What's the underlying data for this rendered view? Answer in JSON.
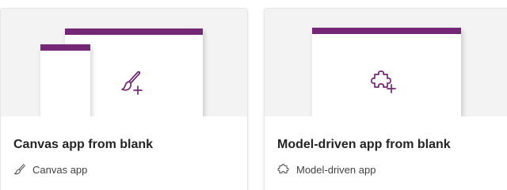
{
  "cards": [
    {
      "title": "Canvas app from blank",
      "subtitle": "Canvas app",
      "icon": "paintbrush-icon",
      "preview_icon": "paintbrush-add-icon"
    },
    {
      "title": "Model-driven app from blank",
      "subtitle": "Model-driven app",
      "icon": "puzzle-piece-icon",
      "preview_icon": "puzzle-add-icon"
    }
  ],
  "colors": {
    "accent": "#742774",
    "preview_bg": "#f3f3f3",
    "title": "#242424",
    "subtitle": "#424242"
  }
}
